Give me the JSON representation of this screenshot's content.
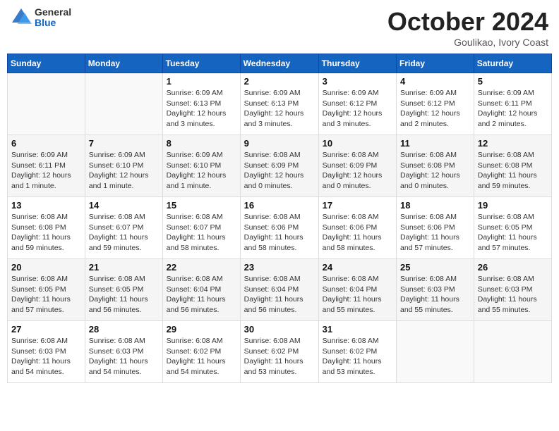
{
  "header": {
    "logo": {
      "line1": "General",
      "line2": "Blue"
    },
    "month": "October 2024",
    "location": "Goulikao, Ivory Coast"
  },
  "weekdays": [
    "Sunday",
    "Monday",
    "Tuesday",
    "Wednesday",
    "Thursday",
    "Friday",
    "Saturday"
  ],
  "weeks": [
    [
      null,
      null,
      {
        "day": 1,
        "sunrise": "Sunrise: 6:09 AM",
        "sunset": "Sunset: 6:13 PM",
        "daylight": "Daylight: 12 hours and 3 minutes."
      },
      {
        "day": 2,
        "sunrise": "Sunrise: 6:09 AM",
        "sunset": "Sunset: 6:13 PM",
        "daylight": "Daylight: 12 hours and 3 minutes."
      },
      {
        "day": 3,
        "sunrise": "Sunrise: 6:09 AM",
        "sunset": "Sunset: 6:12 PM",
        "daylight": "Daylight: 12 hours and 3 minutes."
      },
      {
        "day": 4,
        "sunrise": "Sunrise: 6:09 AM",
        "sunset": "Sunset: 6:12 PM",
        "daylight": "Daylight: 12 hours and 2 minutes."
      },
      {
        "day": 5,
        "sunrise": "Sunrise: 6:09 AM",
        "sunset": "Sunset: 6:11 PM",
        "daylight": "Daylight: 12 hours and 2 minutes."
      }
    ],
    [
      {
        "day": 6,
        "sunrise": "Sunrise: 6:09 AM",
        "sunset": "Sunset: 6:11 PM",
        "daylight": "Daylight: 12 hours and 1 minute."
      },
      {
        "day": 7,
        "sunrise": "Sunrise: 6:09 AM",
        "sunset": "Sunset: 6:10 PM",
        "daylight": "Daylight: 12 hours and 1 minute."
      },
      {
        "day": 8,
        "sunrise": "Sunrise: 6:09 AM",
        "sunset": "Sunset: 6:10 PM",
        "daylight": "Daylight: 12 hours and 1 minute."
      },
      {
        "day": 9,
        "sunrise": "Sunrise: 6:08 AM",
        "sunset": "Sunset: 6:09 PM",
        "daylight": "Daylight: 12 hours and 0 minutes."
      },
      {
        "day": 10,
        "sunrise": "Sunrise: 6:08 AM",
        "sunset": "Sunset: 6:09 PM",
        "daylight": "Daylight: 12 hours and 0 minutes."
      },
      {
        "day": 11,
        "sunrise": "Sunrise: 6:08 AM",
        "sunset": "Sunset: 6:08 PM",
        "daylight": "Daylight: 12 hours and 0 minutes."
      },
      {
        "day": 12,
        "sunrise": "Sunrise: 6:08 AM",
        "sunset": "Sunset: 6:08 PM",
        "daylight": "Daylight: 11 hours and 59 minutes."
      }
    ],
    [
      {
        "day": 13,
        "sunrise": "Sunrise: 6:08 AM",
        "sunset": "Sunset: 6:08 PM",
        "daylight": "Daylight: 11 hours and 59 minutes."
      },
      {
        "day": 14,
        "sunrise": "Sunrise: 6:08 AM",
        "sunset": "Sunset: 6:07 PM",
        "daylight": "Daylight: 11 hours and 59 minutes."
      },
      {
        "day": 15,
        "sunrise": "Sunrise: 6:08 AM",
        "sunset": "Sunset: 6:07 PM",
        "daylight": "Daylight: 11 hours and 58 minutes."
      },
      {
        "day": 16,
        "sunrise": "Sunrise: 6:08 AM",
        "sunset": "Sunset: 6:06 PM",
        "daylight": "Daylight: 11 hours and 58 minutes."
      },
      {
        "day": 17,
        "sunrise": "Sunrise: 6:08 AM",
        "sunset": "Sunset: 6:06 PM",
        "daylight": "Daylight: 11 hours and 58 minutes."
      },
      {
        "day": 18,
        "sunrise": "Sunrise: 6:08 AM",
        "sunset": "Sunset: 6:06 PM",
        "daylight": "Daylight: 11 hours and 57 minutes."
      },
      {
        "day": 19,
        "sunrise": "Sunrise: 6:08 AM",
        "sunset": "Sunset: 6:05 PM",
        "daylight": "Daylight: 11 hours and 57 minutes."
      }
    ],
    [
      {
        "day": 20,
        "sunrise": "Sunrise: 6:08 AM",
        "sunset": "Sunset: 6:05 PM",
        "daylight": "Daylight: 11 hours and 57 minutes."
      },
      {
        "day": 21,
        "sunrise": "Sunrise: 6:08 AM",
        "sunset": "Sunset: 6:05 PM",
        "daylight": "Daylight: 11 hours and 56 minutes."
      },
      {
        "day": 22,
        "sunrise": "Sunrise: 6:08 AM",
        "sunset": "Sunset: 6:04 PM",
        "daylight": "Daylight: 11 hours and 56 minutes."
      },
      {
        "day": 23,
        "sunrise": "Sunrise: 6:08 AM",
        "sunset": "Sunset: 6:04 PM",
        "daylight": "Daylight: 11 hours and 56 minutes."
      },
      {
        "day": 24,
        "sunrise": "Sunrise: 6:08 AM",
        "sunset": "Sunset: 6:04 PM",
        "daylight": "Daylight: 11 hours and 55 minutes."
      },
      {
        "day": 25,
        "sunrise": "Sunrise: 6:08 AM",
        "sunset": "Sunset: 6:03 PM",
        "daylight": "Daylight: 11 hours and 55 minutes."
      },
      {
        "day": 26,
        "sunrise": "Sunrise: 6:08 AM",
        "sunset": "Sunset: 6:03 PM",
        "daylight": "Daylight: 11 hours and 55 minutes."
      }
    ],
    [
      {
        "day": 27,
        "sunrise": "Sunrise: 6:08 AM",
        "sunset": "Sunset: 6:03 PM",
        "daylight": "Daylight: 11 hours and 54 minutes."
      },
      {
        "day": 28,
        "sunrise": "Sunrise: 6:08 AM",
        "sunset": "Sunset: 6:03 PM",
        "daylight": "Daylight: 11 hours and 54 minutes."
      },
      {
        "day": 29,
        "sunrise": "Sunrise: 6:08 AM",
        "sunset": "Sunset: 6:02 PM",
        "daylight": "Daylight: 11 hours and 54 minutes."
      },
      {
        "day": 30,
        "sunrise": "Sunrise: 6:08 AM",
        "sunset": "Sunset: 6:02 PM",
        "daylight": "Daylight: 11 hours and 53 minutes."
      },
      {
        "day": 31,
        "sunrise": "Sunrise: 6:08 AM",
        "sunset": "Sunset: 6:02 PM",
        "daylight": "Daylight: 11 hours and 53 minutes."
      },
      null,
      null
    ]
  ]
}
